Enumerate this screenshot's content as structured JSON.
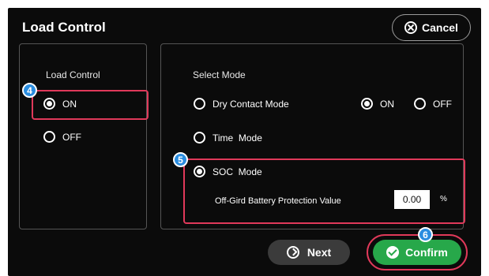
{
  "dialog": {
    "title": "Load Control",
    "cancel_label": "Cancel"
  },
  "load_control": {
    "heading": "Load Control",
    "options": [
      {
        "label": "ON",
        "selected": true
      },
      {
        "label": "OFF",
        "selected": false
      }
    ]
  },
  "select_mode": {
    "heading": "Select Mode",
    "dry_contact": {
      "label": "Dry Contact Mode",
      "selected": false,
      "on_label": "ON",
      "on_selected": true,
      "off_label": "OFF",
      "off_selected": false
    },
    "time_mode": {
      "label": "Time  Mode",
      "selected": false
    },
    "soc_mode": {
      "label": "SOC  Mode",
      "selected": true
    },
    "protection": {
      "label": "Off-Gird Battery Protection Value",
      "value": "0.00",
      "unit": "%"
    }
  },
  "footer": {
    "next_label": "Next",
    "confirm_label": "Confirm"
  },
  "callouts": [
    "4",
    "5",
    "6"
  ],
  "colors": {
    "background": "#0b0b0b",
    "highlight": "#e0395a",
    "badge": "#2a8de0",
    "confirm": "#27a84a",
    "next": "#3b3b3b"
  }
}
